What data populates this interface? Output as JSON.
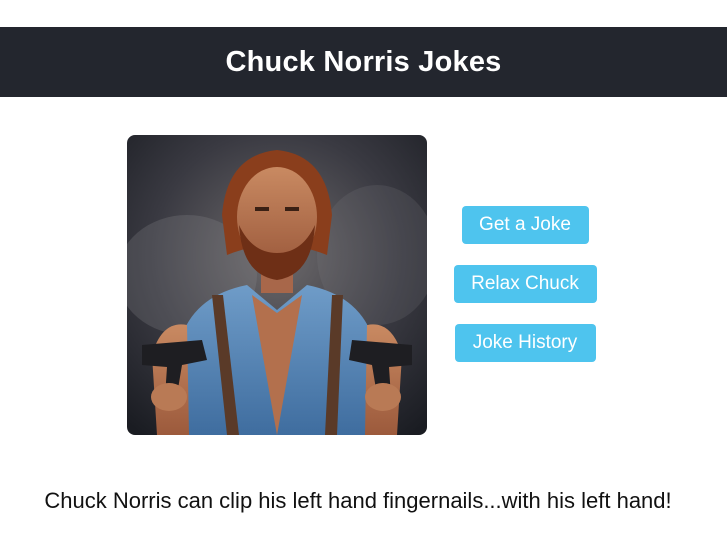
{
  "header": {
    "title": "Chuck Norris Jokes",
    "background": "#23262e"
  },
  "photo": {
    "subject": "chuck-norris-portrait"
  },
  "buttons": {
    "get_joke": "Get a Joke",
    "relax": "Relax Chuck",
    "history": "Joke History",
    "color": "#4ec4ee"
  },
  "joke": {
    "text": "Chuck Norris can clip his left hand fingernails...with his left hand!"
  }
}
